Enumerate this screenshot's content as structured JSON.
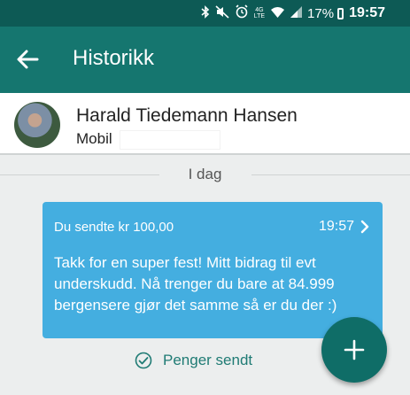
{
  "status_bar": {
    "network_label_top": "4G",
    "network_label_bottom": "LTE",
    "battery": "17%",
    "time": "19:57",
    "icons": [
      "bluetooth-icon",
      "mute-icon",
      "alarm-icon",
      "wifi-icon",
      "signal-icon",
      "battery-icon"
    ]
  },
  "app_bar": {
    "title": "Historikk",
    "back_icon": "arrow-left-icon"
  },
  "contact": {
    "name": "Harald Tiedemann Hansen",
    "phone_label": "Mobil"
  },
  "divider": {
    "label": "I dag"
  },
  "transaction": {
    "summary": "Du sendte kr 100,00",
    "time": "19:57",
    "message": "Takk for en super fest! Mitt bidrag til evt\nunderskudd.  Nå trenger du bare at 84.999\nbergensere gjør det samme så er du der :)"
  },
  "status": {
    "text": "Penger sendt",
    "icon": "check-circle-icon"
  },
  "fab": {
    "icon": "plus-icon"
  },
  "colors": {
    "status_bar": "#0d5a55",
    "app_bar": "#15766f",
    "bubble": "#44aee0",
    "fab": "#0f6d67",
    "accent_text": "#1f7b74"
  }
}
